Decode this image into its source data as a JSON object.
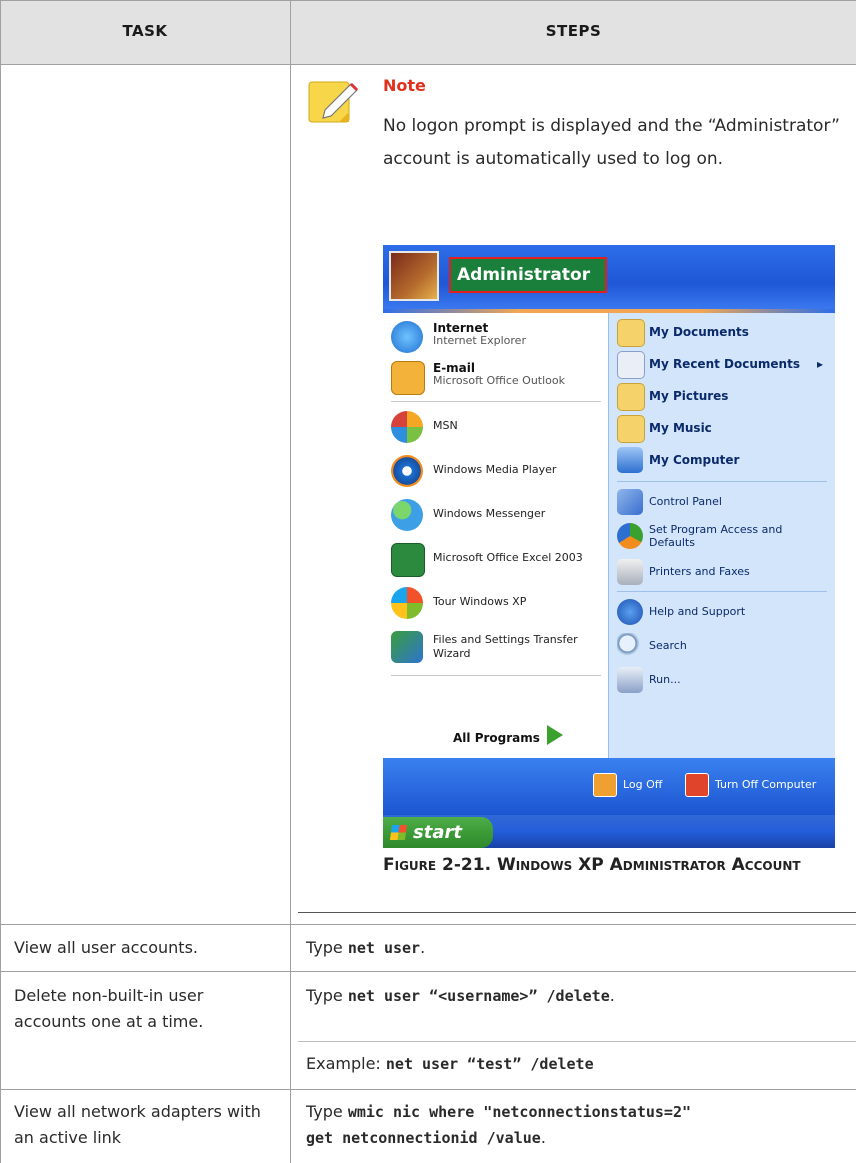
{
  "table": {
    "headers": {
      "task": "Task",
      "steps": "Steps"
    },
    "note": {
      "title": "Note",
      "text": "No logon prompt is displayed and the “Administrator” account is automatically used to log on."
    },
    "figure": {
      "caption": "Figure 2-21. Windows XP Administrator Account"
    },
    "rows": [
      {
        "task": "View all user accounts.",
        "steps_prefix": "Type ",
        "steps_cmd": "net user",
        "steps_suffix": "."
      },
      {
        "task": "Delete non-built-in user accounts one at a time.",
        "steps_prefix": "Type ",
        "steps_cmd": "net user “<username>” /delete",
        "steps_suffix": ".",
        "example_prefix": "Example: ",
        "example_cmd": "net user “test” /delete"
      },
      {
        "task": "View all network adapters with an active link",
        "steps_prefix": "Type ",
        "steps_cmd_line1": "wmic nic where \"netconnectionstatus=2\"",
        "steps_cmd_line2": "get netconnectionid /value",
        "steps_suffix": "."
      }
    ]
  },
  "start_menu": {
    "user": "Administrator",
    "left_items": [
      {
        "title": "Internet",
        "subtitle": "Internet Explorer",
        "icon": "internet-explorer-icon"
      },
      {
        "title": "E-mail",
        "subtitle": "Microsoft Office Outlook",
        "icon": "outlook-icon"
      },
      {
        "label": "MSN",
        "icon": "msn-icon"
      },
      {
        "label": "Windows Media Player",
        "icon": "media-player-icon"
      },
      {
        "label": "Windows Messenger",
        "icon": "messenger-icon"
      },
      {
        "label": "Microsoft Office Excel 2003",
        "icon": "excel-icon"
      },
      {
        "label": "Tour Windows XP",
        "icon": "tour-icon"
      },
      {
        "label": "Files and Settings Transfer Wizard",
        "icon": "transfer-wizard-icon"
      }
    ],
    "all_programs": "All Programs",
    "right_items": [
      {
        "label": "My Documents",
        "icon": "folder-icon"
      },
      {
        "label": "My Recent Documents",
        "icon": "recent-documents-icon"
      },
      {
        "label": "My Pictures",
        "icon": "pictures-icon"
      },
      {
        "label": "My Music",
        "icon": "music-icon"
      },
      {
        "label": "My Computer",
        "icon": "computer-icon"
      },
      {
        "label": "Control Panel",
        "icon": "control-panel-icon"
      },
      {
        "label": "Set Program Access and Defaults",
        "icon": "program-access-icon"
      },
      {
        "label": "Printers and Faxes",
        "icon": "printer-icon"
      },
      {
        "label": "Help and Support",
        "icon": "help-icon"
      },
      {
        "label": "Search",
        "icon": "search-icon"
      },
      {
        "label": "Run...",
        "icon": "run-icon"
      }
    ],
    "log_off": "Log Off",
    "turn_off": "Turn Off Computer",
    "start": "start",
    "submenu_arrow": "▸"
  }
}
